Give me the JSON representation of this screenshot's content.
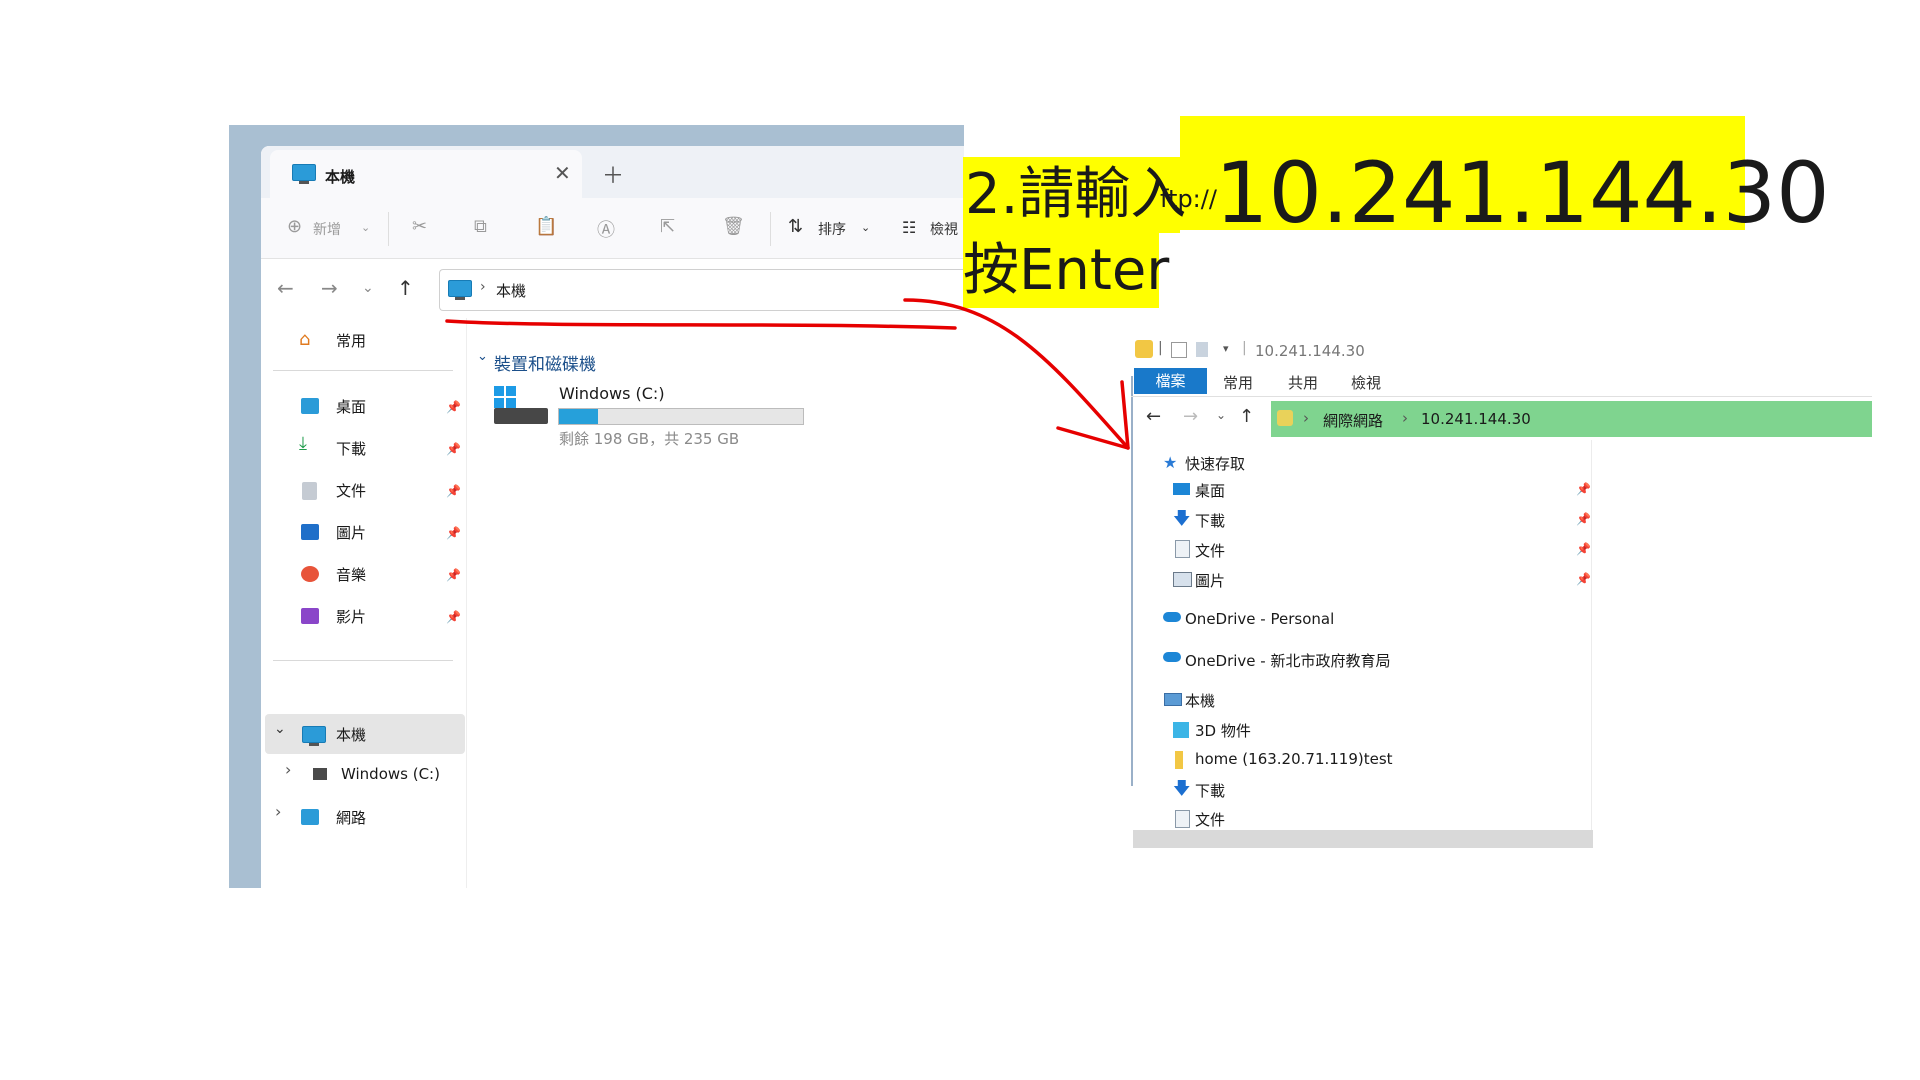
{
  "annotation": {
    "step_label": "2.請輸入",
    "prefix": "ftp://",
    "ip": "10.241.144.30",
    "enter": "按Enter"
  },
  "colors": {
    "highlight": "#ffff00",
    "arrow": "#e60000",
    "address_highlight": "#7fd48f",
    "file_tab": "#1979ca"
  },
  "win11": {
    "tab_title": "本機",
    "toolbar": {
      "new": "新增",
      "sort": "排序",
      "view": "檢視"
    },
    "address": {
      "path": "本機"
    },
    "sidebar": {
      "home": "常用",
      "pinned": [
        "桌面",
        "下載",
        "文件",
        "圖片",
        "音樂",
        "影片"
      ],
      "this_pc": "本機",
      "drive": "Windows (C:)",
      "network": "網路"
    },
    "main": {
      "group_header": "裝置和磁碟機",
      "drive_name": "Windows (C:)",
      "drive_free": "剩餘 198 GB，共 235 GB",
      "drive_used_fraction": 0.16
    }
  },
  "win10": {
    "title": "10.241.144.30",
    "ribbon_tabs": [
      "檔案",
      "常用",
      "共用",
      "檢視"
    ],
    "address": {
      "root": "網際網路",
      "host": "10.241.144.30"
    },
    "sidebar": {
      "quick_access": "快速存取",
      "pinned": [
        "桌面",
        "下載",
        "文件",
        "圖片"
      ],
      "onedrive_personal": "OneDrive - Personal",
      "onedrive_org": "OneDrive - 新北市政府教育局",
      "this_pc": "本機",
      "pc_items": [
        "3D 物件",
        "home (163.20.71.119)test",
        "下載",
        "文件"
      ]
    }
  }
}
